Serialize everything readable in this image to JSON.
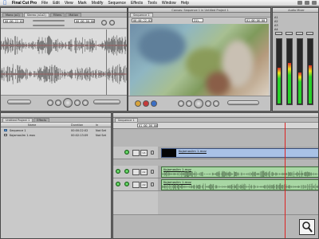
{
  "menubar": {
    "app": "Final Cut Pro",
    "items": [
      "File",
      "Edit",
      "View",
      "Mark",
      "Modify",
      "Sequence",
      "Effects",
      "Tools",
      "Window",
      "Help"
    ]
  },
  "viewer": {
    "tabs": [
      "Mono (a1)",
      "Stereo (a1a2)",
      "Filters",
      "Motion"
    ],
    "timecode_left": "00:00:22:02",
    "timecode_right": "00:00:00:00"
  },
  "canvas": {
    "title": "Canvas: Sequence 1 in Untitled Project 1",
    "tab": "Sequence 1",
    "timecode_left": "00:00:22:02",
    "timecode_right": "01:00:06:00",
    "zoom": "31%"
  },
  "audio_meters": {
    "title": "Audio Mixer",
    "tracks": [
      "A1",
      "A2",
      "A3",
      "A4"
    ],
    "levels": [
      0.55,
      0.62,
      0.48,
      0.58
    ]
  },
  "browser": {
    "tabs": [
      "Untitled Project 1",
      "Effects"
    ],
    "columns": [
      "Name",
      "Duration",
      "In"
    ],
    "rows": [
      {
        "icon": "sequence-icon",
        "name": "Sequence 1",
        "duration": "00:00:22:02",
        "in": "Not Set"
      },
      {
        "icon": "clip-icon",
        "name": "Kojamaslim 1.mov",
        "duration": "00:02:13:09",
        "in": "Not Set"
      }
    ]
  },
  "timeline": {
    "tab": "Sequence 1",
    "timecode": "01:00:06:00",
    "tracks": [
      {
        "type": "video",
        "label": "V1",
        "clip": "Kojamaslim 1.mov"
      },
      {
        "type": "audio",
        "label": "A1",
        "clip": "Kojamaslim 1.mov"
      },
      {
        "type": "audio",
        "label": "A2",
        "clip": "Kojamaslim 1.mov"
      }
    ]
  },
  "colors": {
    "video_clip": "#a9c1e6",
    "audio_clip": "#a8d7a4",
    "playhead": "#dd2222",
    "meter_green": "#2bd02b"
  }
}
